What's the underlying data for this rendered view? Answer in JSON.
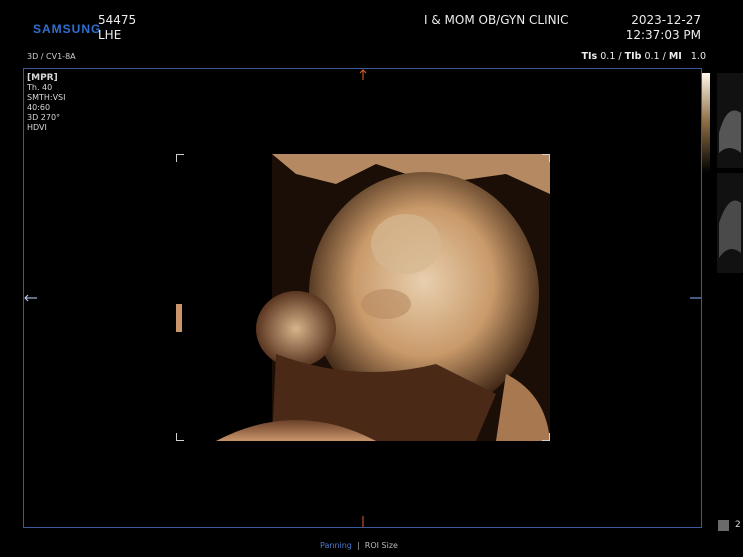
{
  "header": {
    "brand": "SAMSUNG",
    "patient_id": "54475",
    "patient_name": "LHE",
    "clinic": "I & MOM OB/GYN CLINIC",
    "date": "2023-12-27",
    "time": "12:37:03 PM"
  },
  "probe": "3D / CV1-8A",
  "safety": {
    "tis_label": "TIs",
    "tis": "0.1",
    "tib_label": "TIb",
    "tib": "0.1",
    "mi_label": "MI",
    "mi": "1.0"
  },
  "params": {
    "mode": "[MPR]",
    "thickness": "Th. 40",
    "smoothing": "SMTH:VSI",
    "ratio": "40:60",
    "rotation": "3D 270°",
    "render": "HDVI"
  },
  "tabs": {
    "panning": "Panning",
    "roi_size": "ROI Size"
  },
  "layout_number": "2",
  "colors": {
    "frame": "#3a5a9a",
    "brand": "#2f6fd0",
    "flesh": "#d9b48c"
  }
}
